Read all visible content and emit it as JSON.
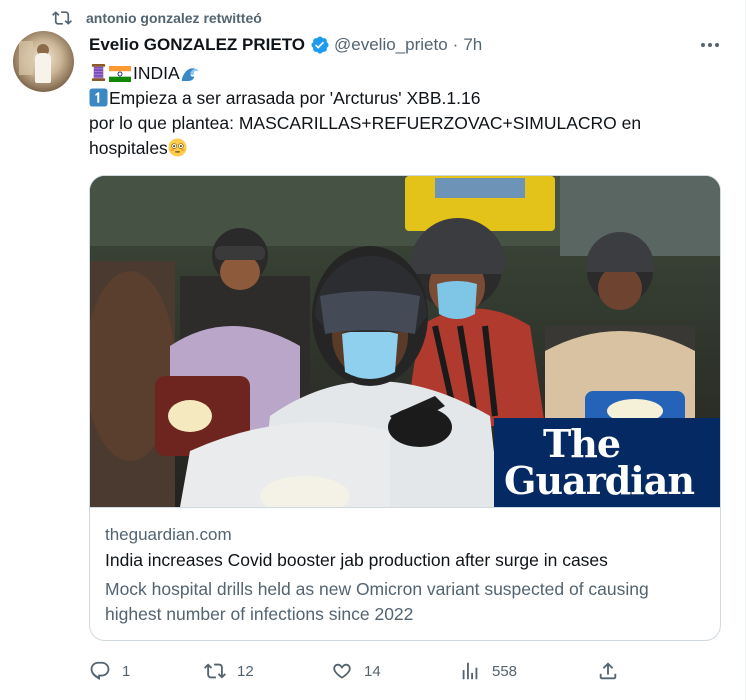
{
  "retweet": {
    "text": "antonio gonzalez retwitteó",
    "icon": "retweet-icon"
  },
  "author": {
    "name": "Evelio GONZALEZ PRIETO",
    "handle": "@evelio_prieto",
    "separator": "·",
    "time": "7h",
    "verified_color": "#1d9bf0"
  },
  "tweet": {
    "line1_text": "INDIA",
    "line2_text": "Empieza a ser arrasada por 'Arcturus' XBB.1.16",
    "line3_text": "por lo que plantea:  MASCARILLAS+REFUERZOVAC+SIMULACRO en",
    "line4_text": "hospitales",
    "emojis": [
      "thread-icon",
      "india-flag-icon",
      "wave-icon",
      "keycap-one-icon",
      "flushed-face-icon"
    ]
  },
  "card": {
    "image_alt": "People wearing masks riding motorcycles in India",
    "logo_line1": "The",
    "logo_line2": "Guardian",
    "logo_bg": "#052962",
    "domain": "theguardian.com",
    "title": "India increases Covid booster jab production after surge in cases",
    "description": "Mock hospital drills held as new Omicron variant suspected of causing highest number of infections since 2022"
  },
  "actions": {
    "replies": "1",
    "retweets": "12",
    "likes": "14",
    "views": "558"
  },
  "colors": {
    "text": "#0f1419",
    "muted": "#536471",
    "border": "#cfd9de",
    "accent": "#1d9bf0"
  }
}
